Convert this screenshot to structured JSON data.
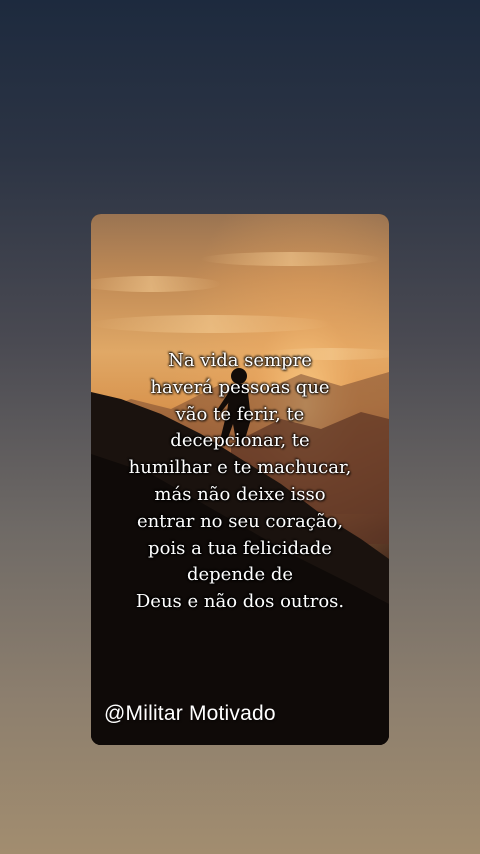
{
  "post": {
    "quote_lines": [
      "Na vida sempre",
      "haverá pessoas que",
      "vão te ferir, te",
      "decepcionar, te",
      "humilhar e te machucar,",
      "más não deixe isso",
      "entrar no seu coração,",
      "pois a tua felicidade",
      "depende de",
      "Deus e não dos outros."
    ],
    "handle": "@Militar Motivado"
  },
  "colors": {
    "sky_top": "#b07a4a",
    "sky_glow": "#f1c27a",
    "mountain_dark": "#140f0c",
    "text": "#ffffff"
  }
}
